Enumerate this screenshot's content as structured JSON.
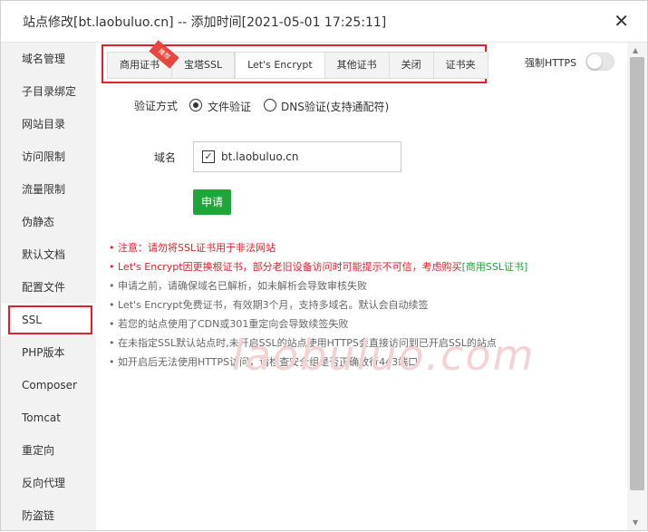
{
  "dialog": {
    "title": "站点修改[bt.laobuluo.cn] -- 添加时间[2021-05-01 17:25:11]",
    "close_glyph": "✕"
  },
  "sidebar": {
    "items": [
      {
        "label": "域名管理"
      },
      {
        "label": "子目录绑定"
      },
      {
        "label": "网站目录"
      },
      {
        "label": "访问限制"
      },
      {
        "label": "流量限制"
      },
      {
        "label": "伪静态"
      },
      {
        "label": "默认文档"
      },
      {
        "label": "配置文件"
      },
      {
        "label": "SSL"
      },
      {
        "label": "PHP版本"
      },
      {
        "label": "Composer"
      },
      {
        "label": "Tomcat"
      },
      {
        "label": "重定向"
      },
      {
        "label": "反向代理"
      },
      {
        "label": "防盗链"
      }
    ],
    "active": "SSL"
  },
  "tabs": {
    "items": [
      {
        "label": "商用证书"
      },
      {
        "label": "宝塔SSL"
      },
      {
        "label": "Let's Encrypt"
      },
      {
        "label": "其他证书"
      },
      {
        "label": "关闭"
      },
      {
        "label": "证书夹"
      }
    ],
    "active": "Let's Encrypt",
    "recommend_ribbon": "推荐"
  },
  "https": {
    "label": "强制HTTPS",
    "enabled": false
  },
  "form": {
    "verify_label": "验证方式",
    "option_file": "文件验证",
    "option_dns": "DNS验证(支持通配符)",
    "selected": "文件验证",
    "domain_label": "域名",
    "domain_value": "bt.laobuluo.cn",
    "domain_checked": true,
    "apply_label": "申请"
  },
  "notes": {
    "n1": "注意：请勿将SSL证书用于非法网站",
    "n2_text": "Let's Encrypt因更换根证书，部分老旧设备访问时可能提示不可信，考虑购买",
    "n2_link": "[商用SSL证书]",
    "n3": "申请之前，请确保域名已解析，如未解析会导致审核失败",
    "n4": "Let's Encrypt免费证书，有效期3个月，支持多域名。默认会自动续签",
    "n5": "若您的站点使用了CDN或301重定向会导致续签失败",
    "n6": "在未指定SSL默认站点时,未开启SSL的站点使用HTTPS会直接访问到已开启SSL的站点",
    "n7": "如开启后无法使用HTTPS访问，请检查安全组是否正确放行443端口"
  },
  "watermark": "laobuluo.com",
  "colors": {
    "accent_green": "#20a53a",
    "highlight_red": "#e0212d"
  }
}
